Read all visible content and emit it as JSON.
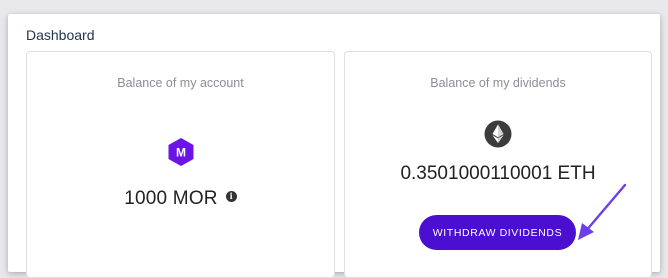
{
  "dashboard": {
    "title": "Dashboard"
  },
  "account_card": {
    "label": "Balance of my account",
    "icon": "mor-token-icon",
    "icon_letter": "M",
    "value": "1000 MOR",
    "info_icon": "info-icon",
    "info_glyph": "i"
  },
  "dividends_card": {
    "label": "Balance of my dividends",
    "icon": "ethereum-icon",
    "value": "0.3501000110001 ETH",
    "button_label": "WITHDRAW DIVIDENDS"
  },
  "colors": {
    "accent": "#4a0fd1",
    "mor_icon": "#6b14e3",
    "eth_icon": "#3c3c3d",
    "arrow": "#6c3ef0",
    "title": "#24344d"
  }
}
